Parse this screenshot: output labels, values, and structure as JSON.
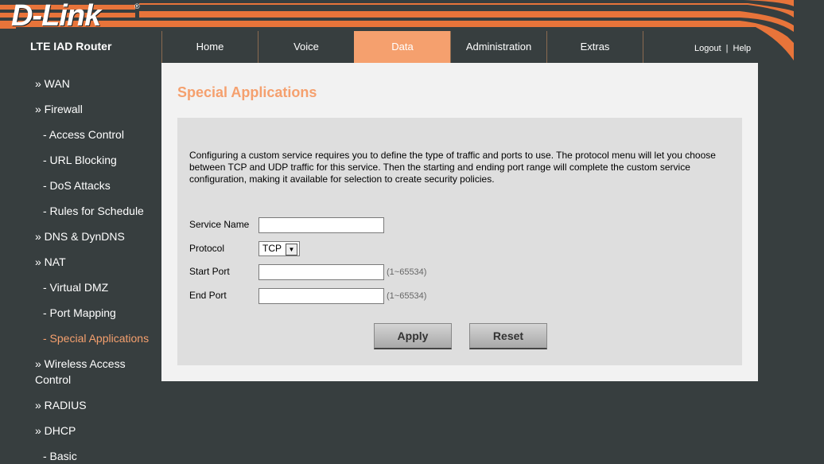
{
  "brand": {
    "logo_text": "D-Link",
    "registered": "®",
    "product": "LTE IAD Router"
  },
  "topnav": {
    "tabs": [
      {
        "label": "Home"
      },
      {
        "label": "Voice"
      },
      {
        "label": "Data",
        "active": true
      },
      {
        "label": "Administration"
      },
      {
        "label": "Extras"
      }
    ],
    "logout": "Logout",
    "separator": "|",
    "help": "Help"
  },
  "sidebar": {
    "items": [
      {
        "label": "» WAN",
        "level": 1
      },
      {
        "label": "» Firewall",
        "level": 1
      },
      {
        "label": "- Access Control",
        "level": 2
      },
      {
        "label": "- URL Blocking",
        "level": 2
      },
      {
        "label": "- DoS Attacks",
        "level": 2
      },
      {
        "label": "- Rules for Schedule",
        "level": 2
      },
      {
        "label": "» DNS & DynDNS",
        "level": 1
      },
      {
        "label": "» NAT",
        "level": 1
      },
      {
        "label": "- Virtual DMZ",
        "level": 2
      },
      {
        "label": "- Port Mapping",
        "level": 2
      },
      {
        "label": "- Special Applications",
        "level": 2,
        "active": true
      },
      {
        "label": "» Wireless Access",
        "level": 1
      },
      {
        "label": "Control",
        "level": 1
      },
      {
        "label": "» RADIUS",
        "level": 1
      },
      {
        "label": "» DHCP",
        "level": 1
      },
      {
        "label": "- Basic",
        "level": 2
      }
    ]
  },
  "main": {
    "title": "Special Applications",
    "description": "Configuring a custom service requires you to define the type of traffic and ports to use. The protocol menu will let you choose between TCP and UDP traffic for this service. Then the starting and ending port range will complete the custom service configuration, making it available for selection to create security policies.",
    "form": {
      "service_name_label": "Service Name",
      "service_name_value": "",
      "protocol_label": "Protocol",
      "protocol_value": "TCP",
      "start_port_label": "Start Port",
      "start_port_value": "",
      "start_port_hint": "(1~65534)",
      "end_port_label": "End Port",
      "end_port_value": "",
      "end_port_hint": "(1~65534)"
    },
    "buttons": {
      "apply": "Apply",
      "reset": "Reset"
    }
  },
  "colors": {
    "accent": "#f5a06e",
    "brand_orange": "#e8743a",
    "background": "#373e3f"
  }
}
